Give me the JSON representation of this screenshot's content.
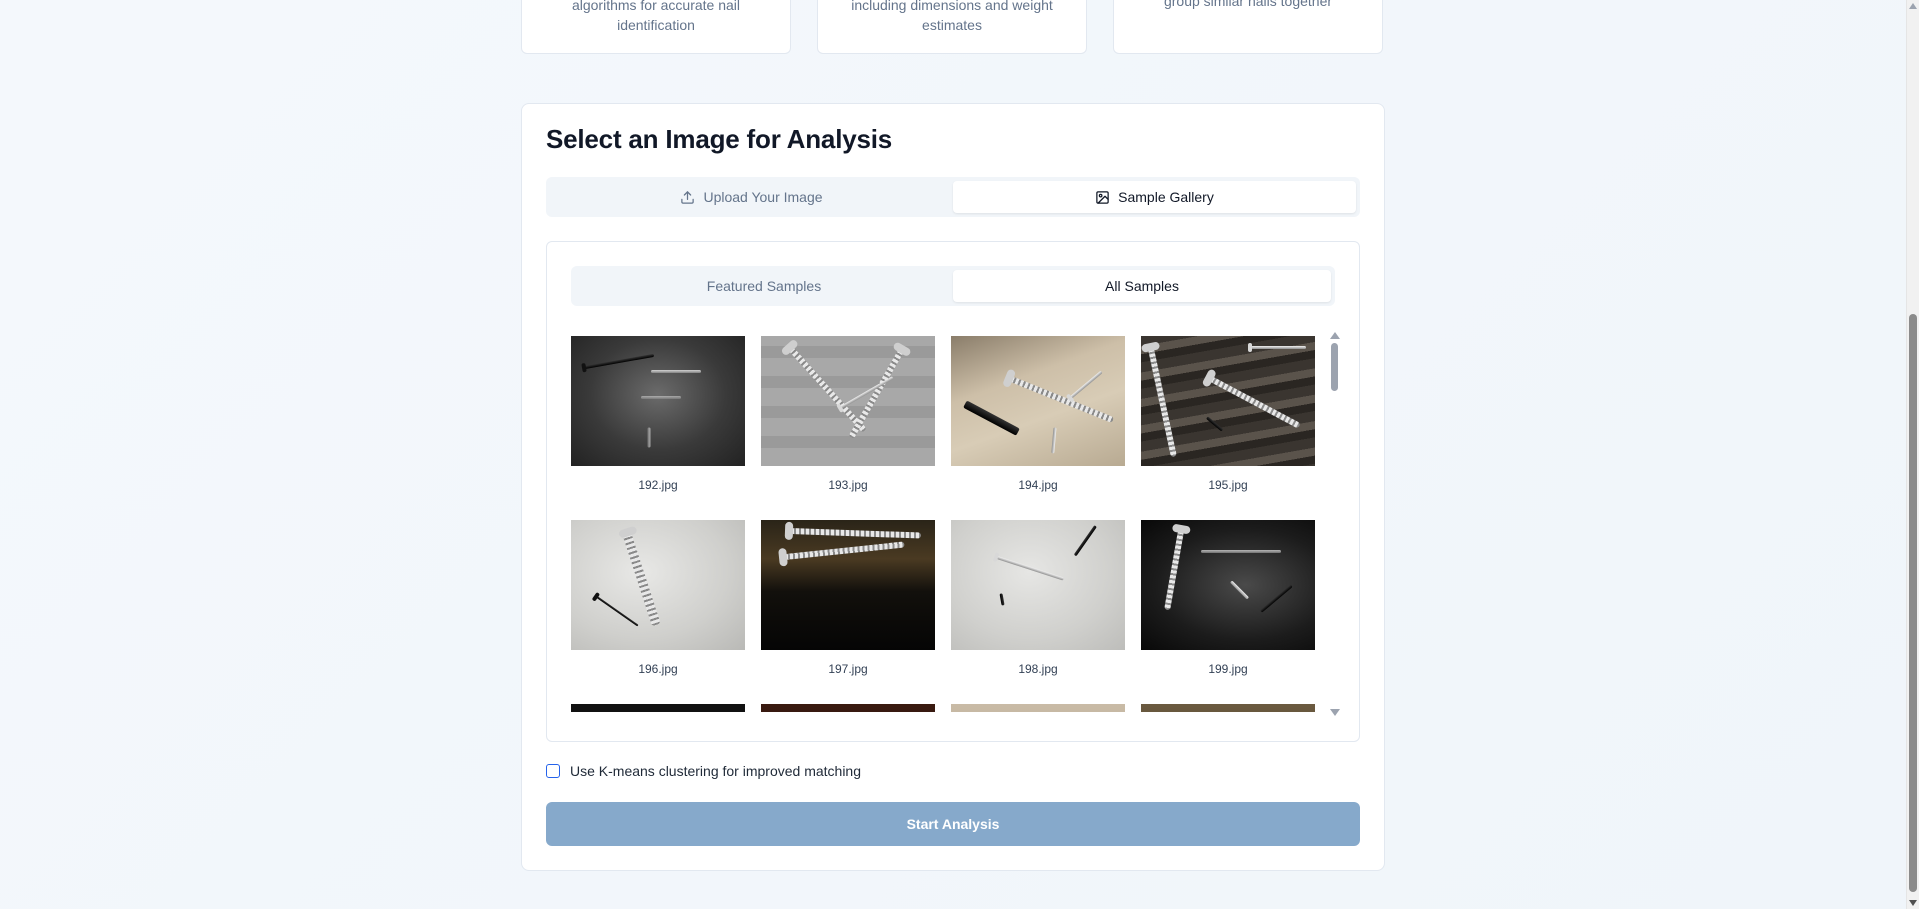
{
  "features": [
    {
      "desc_line1": "algorithms for accurate nail",
      "desc_line2": "identification"
    },
    {
      "desc_line1": "including dimensions and weight",
      "desc_line2": "estimates"
    },
    {
      "desc_line1": "group similar nails together",
      "desc_line2": ""
    }
  ],
  "panel": {
    "title": "Select an Image for Analysis",
    "tabs": [
      {
        "label": "Upload Your Image",
        "icon": "upload-icon",
        "active": false
      },
      {
        "label": "Sample Gallery",
        "icon": "image-icon",
        "active": true
      }
    ]
  },
  "gallery": {
    "tabs": [
      {
        "label": "Featured Samples",
        "active": false
      },
      {
        "label": "All Samples",
        "active": true
      }
    ],
    "images": [
      {
        "name": "192.jpg"
      },
      {
        "name": "193.jpg"
      },
      {
        "name": "194.jpg"
      },
      {
        "name": "195.jpg"
      },
      {
        "name": "196.jpg"
      },
      {
        "name": "197.jpg"
      },
      {
        "name": "198.jpg"
      },
      {
        "name": "199.jpg"
      }
    ]
  },
  "options": {
    "kmeans_label": "Use K-means clustering for improved matching",
    "kmeans_checked": false
  },
  "actions": {
    "start_label": "Start Analysis",
    "start_enabled": false
  },
  "colors": {
    "accent": "#2563eb",
    "button_disabled": "#86a9cb"
  }
}
